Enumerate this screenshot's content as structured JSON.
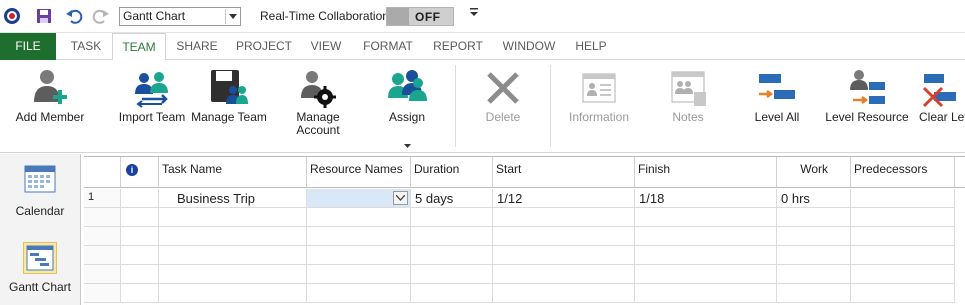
{
  "quick_access": {
    "view_select_value": "Gantt Chart",
    "collab_label": "Real-Time Collaboration",
    "collab_state": "OFF",
    "more_glyph": "≡"
  },
  "tabs": [
    {
      "label": "FILE"
    },
    {
      "label": "TASK"
    },
    {
      "label": "TEAM"
    },
    {
      "label": "SHARE"
    },
    {
      "label": "PROJECT"
    },
    {
      "label": "VIEW"
    },
    {
      "label": "FORMAT"
    },
    {
      "label": "REPORT"
    },
    {
      "label": "WINDOW"
    },
    {
      "label": "HELP"
    }
  ],
  "active_tab": "TEAM",
  "ribbon": {
    "add_member": "Add Member",
    "import_team": "Import Team",
    "manage_team": "Manage Team",
    "manage_account_1": "Manage",
    "manage_account_2": "Account",
    "assign": "Assign",
    "delete": "Delete",
    "information": "Information",
    "notes": "Notes",
    "level_all": "Level All",
    "level_resource": "Level Resource",
    "clear_leveling": "Clear Lev"
  },
  "view_bar": {
    "calendar": "Calendar",
    "gantt_chart": "Gantt Chart"
  },
  "grid": {
    "headers": {
      "info": "i",
      "task_name": "Task Name",
      "resource_names": "Resource Names",
      "duration": "Duration",
      "start": "Start",
      "finish": "Finish",
      "work": "Work",
      "predecessors": "Predecessors"
    },
    "rows": [
      {
        "id": "1",
        "task_name": "Business Trip",
        "resource_names": "",
        "duration": "5 days",
        "start": "1/12",
        "finish": "1/18",
        "work": "0 hrs",
        "predecessors": ""
      }
    ]
  },
  "colors": {
    "file_tab": "#1e6e2e",
    "active_tab_text": "#2a7a3a",
    "selected_cell": "#d9e7f7"
  }
}
